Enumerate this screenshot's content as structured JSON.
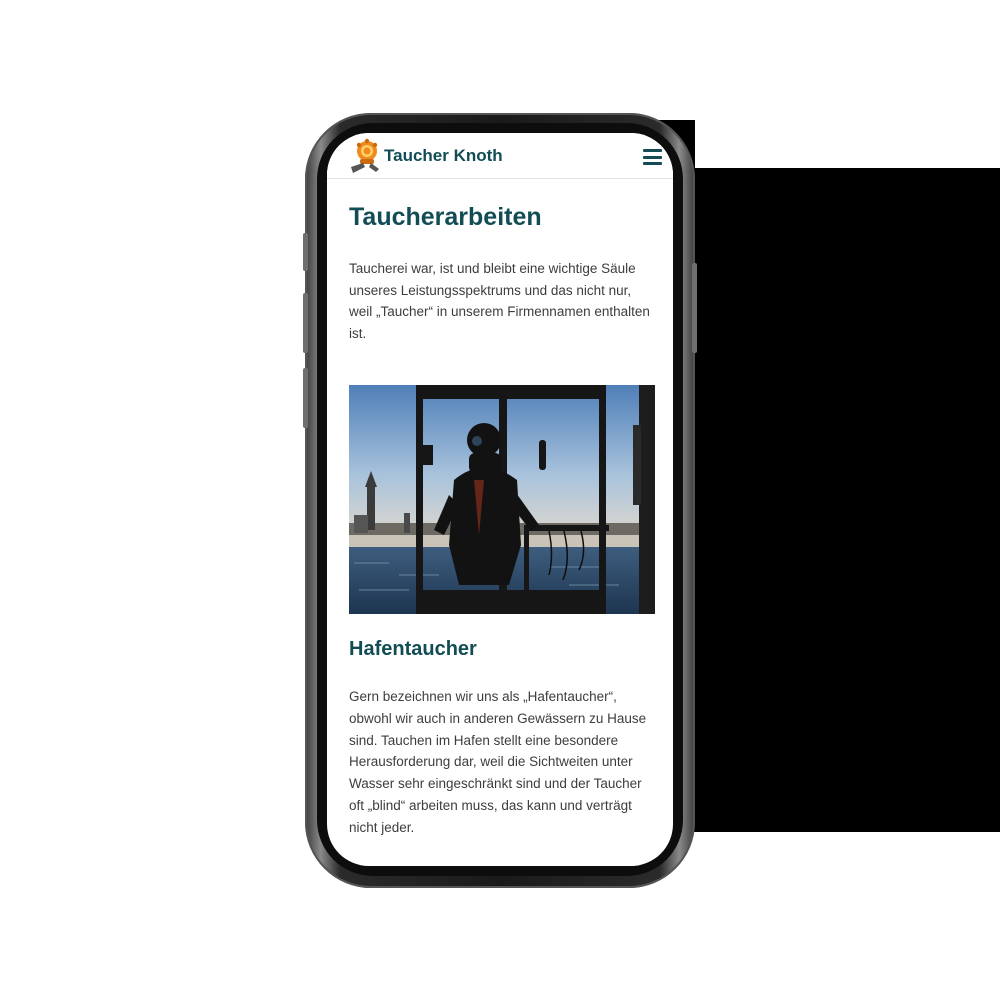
{
  "header": {
    "brand": "Taucher Knoth",
    "logo_icon": "diver-helmet-icon",
    "menu_icon": "hamburger-menu-icon"
  },
  "main": {
    "title": "Taucherarbeiten",
    "intro": "Taucherei war, ist und bleibt eine wichtige Säule unseres Leistungsspektrums und das nicht nur, weil „Taucher“ in unserem Firmennamen enthalten ist.",
    "section_title": "Hafentaucher",
    "section_text": "Gern bezeichnen wir uns als „Hafentaucher“, obwohl wir auch in anderen Gewässern zu Hause sind. Tauchen im Hafen stellt eine besondere Herausforderung dar, weil die Sichtweiten unter Wasser sehr eingeschränkt sind und der Taucher oft „blind“ arbeiten muss, das kann und verträgt nicht jeder."
  },
  "colors": {
    "brand": "#124d55",
    "text": "#3d3d3d",
    "logo_orange": "#f08a1c"
  }
}
